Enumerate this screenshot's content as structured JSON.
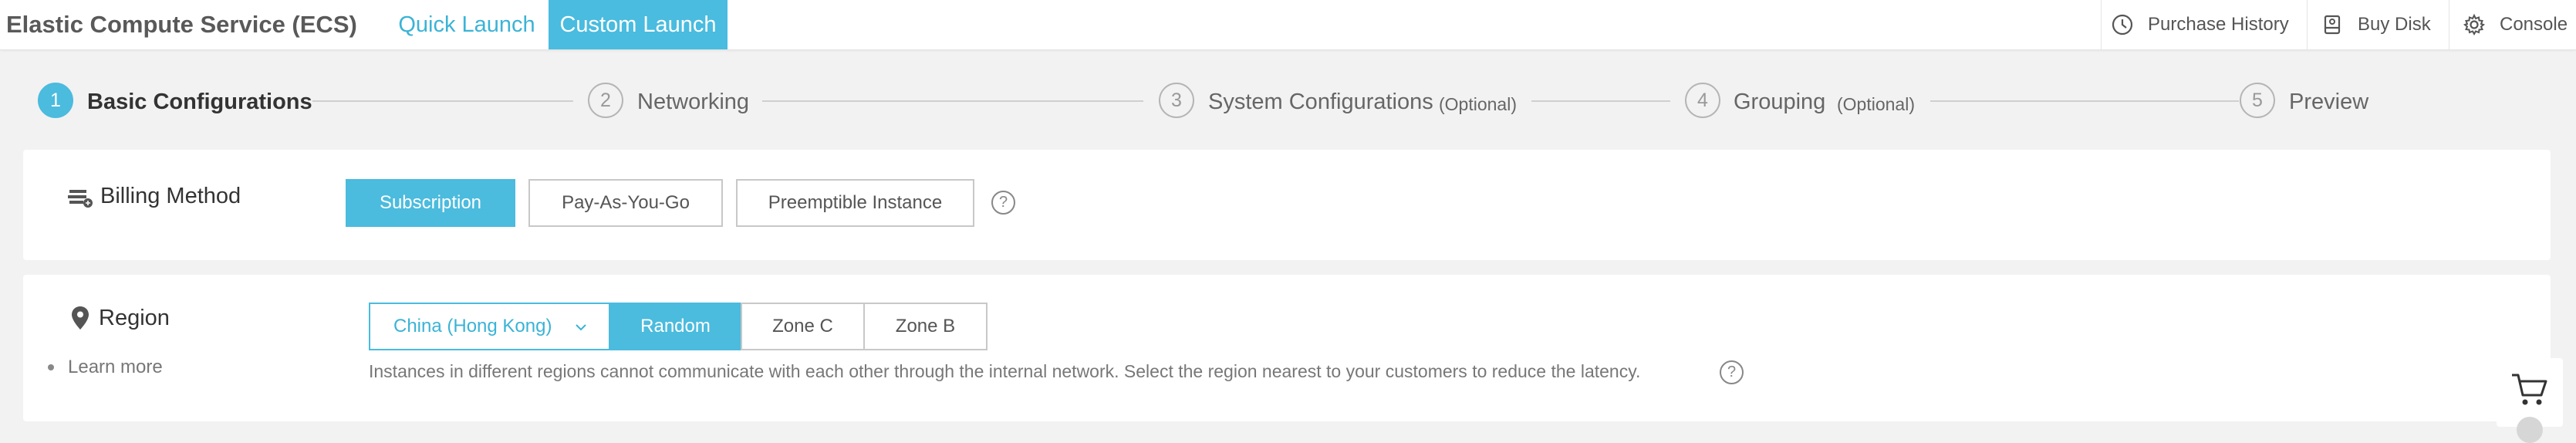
{
  "header": {
    "app_title": "Elastic Compute Service (ECS)",
    "tabs": [
      {
        "label": "Quick Launch",
        "active": false
      },
      {
        "label": "Custom Launch",
        "active": true
      }
    ],
    "links": [
      {
        "label": "Purchase History",
        "icon": "clock-icon"
      },
      {
        "label": "Buy Disk",
        "icon": "disk-icon"
      },
      {
        "label": "Console",
        "icon": "gear-icon"
      }
    ]
  },
  "stepper": {
    "steps": [
      {
        "number": "1",
        "label": "Basic Configurations",
        "optional": "",
        "active": true
      },
      {
        "number": "2",
        "label": "Networking",
        "optional": "",
        "active": false
      },
      {
        "number": "3",
        "label": "System Configurations",
        "optional": "(Optional)",
        "active": false
      },
      {
        "number": "4",
        "label": "Grouping",
        "optional": "(Optional)",
        "active": false
      },
      {
        "number": "5",
        "label": "Preview",
        "optional": "",
        "active": false
      }
    ]
  },
  "billing": {
    "label": "Billing Method",
    "icon": "billing-icon",
    "options": [
      {
        "label": "Subscription",
        "selected": true
      },
      {
        "label": "Pay-As-You-Go",
        "selected": false
      },
      {
        "label": "Preemptible Instance",
        "selected": false
      }
    ],
    "help": "?"
  },
  "region": {
    "label": "Region",
    "icon": "location-pin-icon",
    "learn_more": "Learn more",
    "selected_region": "China (Hong Kong)",
    "zones": [
      {
        "label": "Random",
        "selected": true
      },
      {
        "label": "Zone C",
        "selected": false
      },
      {
        "label": "Zone B",
        "selected": false
      }
    ],
    "hint": "Instances in different regions cannot communicate with each other through the internal network. Select the region nearest to your customers to reduce the latency.",
    "help": "?"
  },
  "colors": {
    "accent": "#4bbbde",
    "accent_text": "#3bb3d6",
    "background": "#f2f2f2"
  }
}
